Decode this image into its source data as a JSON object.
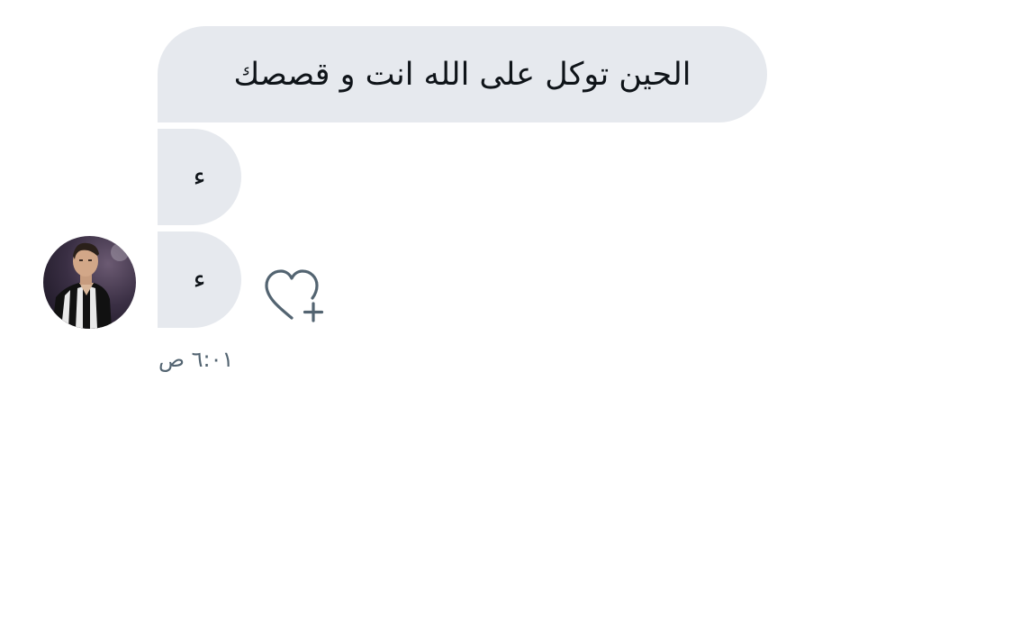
{
  "conversation": {
    "messages": [
      {
        "text": "الحين توكل على الله انت و قصصك"
      },
      {
        "text": "ء"
      },
      {
        "text": "ء"
      }
    ],
    "timestamp": "٦:٠١ ص"
  },
  "icons": {
    "avatar": "user-avatar-photo",
    "reaction": "heart-plus-icon"
  },
  "colors": {
    "bubble_bg": "#e6e9ee",
    "text": "#0f1419",
    "meta_text": "#536471",
    "icon_stroke": "#536471"
  }
}
